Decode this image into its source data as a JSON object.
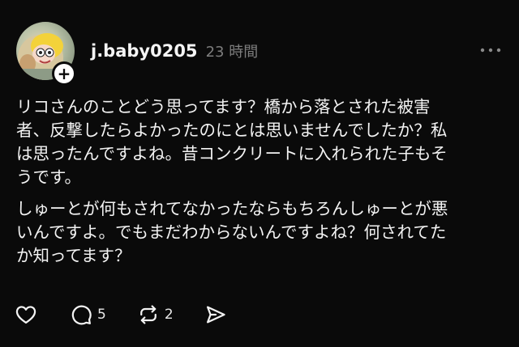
{
  "post": {
    "username": "j.baby0205",
    "timestamp": "23 時間",
    "body": {
      "paragraph1": [
        "リコさんのことどう思ってます？橋から落とされた被害",
        "者、反撃したらよかったのにとは思いませんでしたか？私",
        "は思ったんですよね。昔コンクリートに入れられた子もそ",
        "うです。"
      ],
      "paragraph2": [
        "しゅーとが何もされてなかったならもちろんしゅーとが悪",
        "いんですよ。でもまだわからないんですよね？何されてた",
        "か知ってます？"
      ]
    },
    "follow_symbol": "+",
    "actions": {
      "like_icon": "heart-icon",
      "reply_icon": "comment-icon",
      "reply_count": "5",
      "repost_icon": "repost-icon",
      "repost_count": "2",
      "share_icon": "send-icon"
    },
    "more_icon": "more-horizontal-icon"
  },
  "colors": {
    "background": "#0a0a0a",
    "text": "#f3f3f3",
    "muted": "#7d7d7d"
  }
}
